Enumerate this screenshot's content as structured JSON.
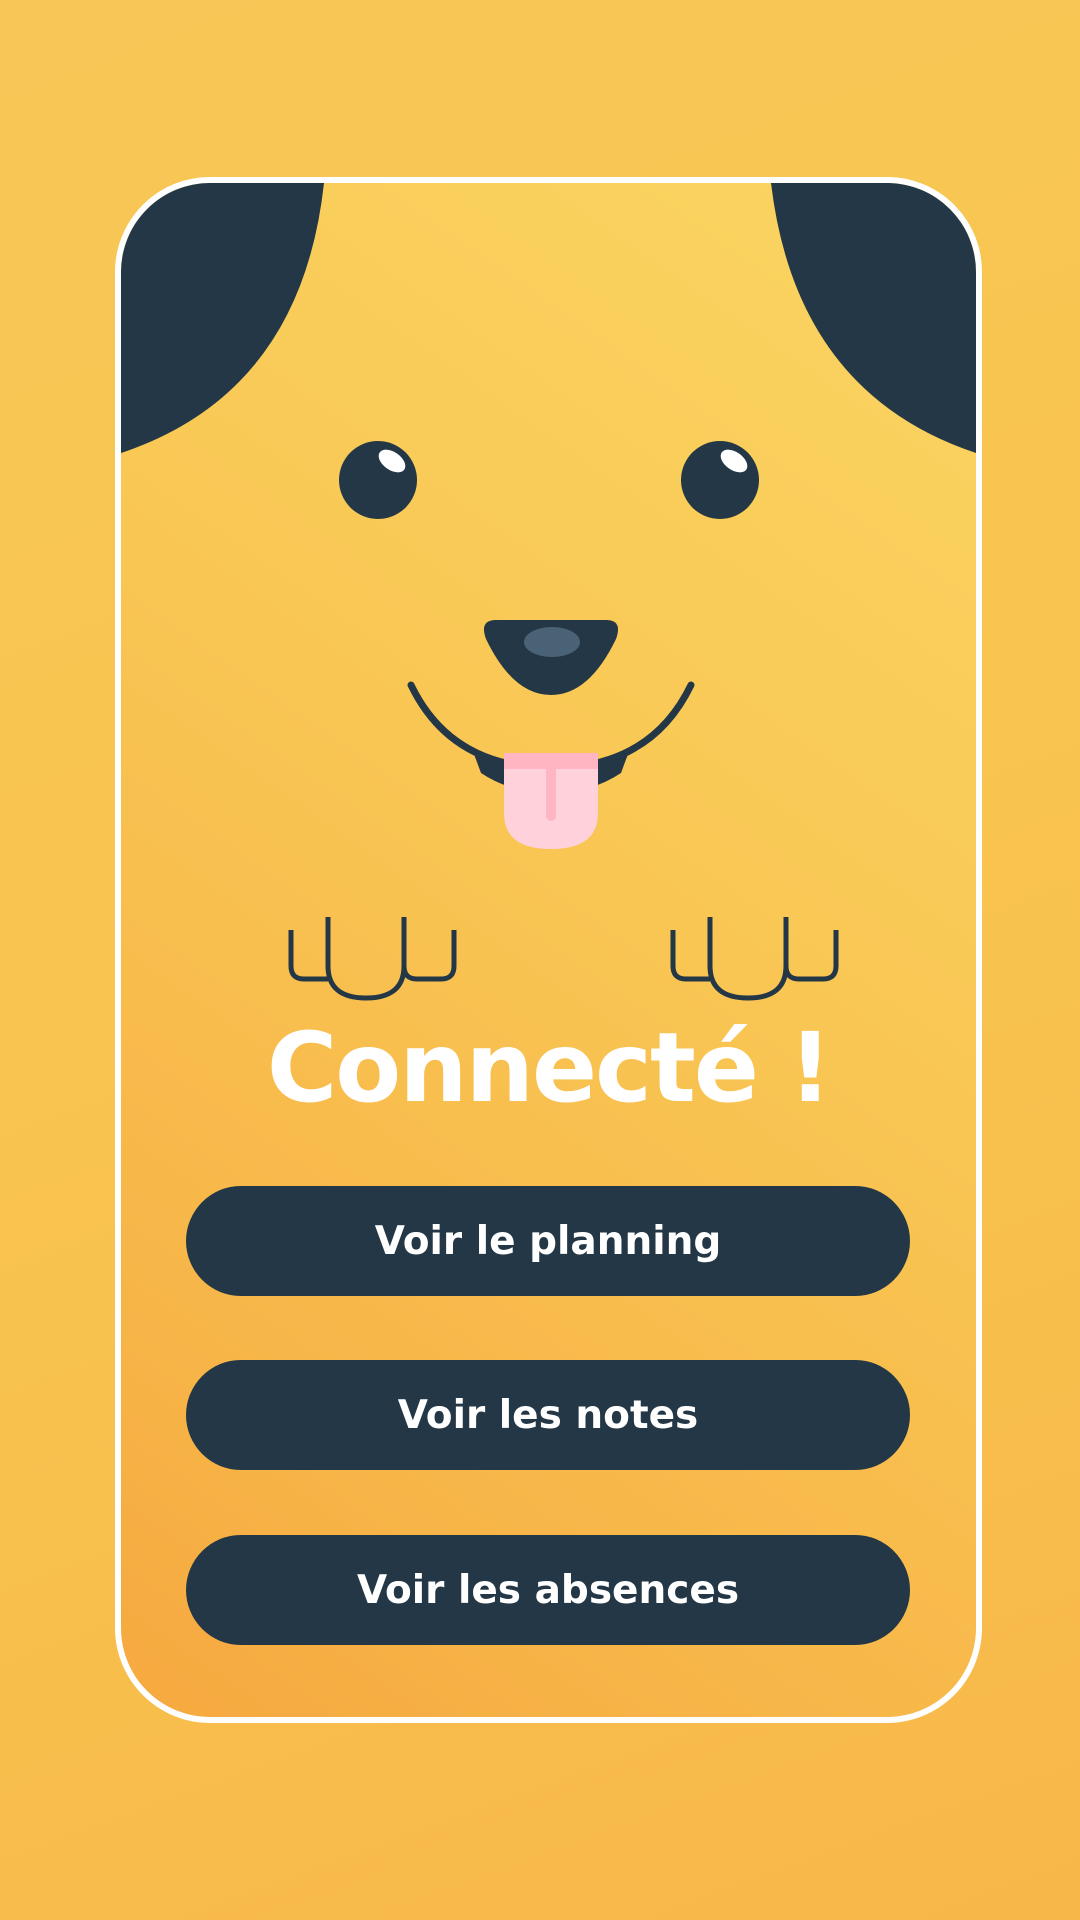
{
  "colors": {
    "background": "#f8c656",
    "card_border": "#ffffff",
    "dark": "#233746",
    "tongue": "#ffd1da",
    "tongue_line": "#ffb5c2",
    "nose_highlight": "#4a6275",
    "text_light": "#ffffff"
  },
  "icons": {
    "left_ear": "ear",
    "right_ear": "ear",
    "eyes": "eye",
    "nose": "nose",
    "mouth": "smile-with-tongue",
    "paws": "paw"
  },
  "status": {
    "title": "Connecté !"
  },
  "actions": {
    "planning_label": "Voir le planning",
    "notes_label": "Voir les notes",
    "absences_label": "Voir les absences"
  }
}
